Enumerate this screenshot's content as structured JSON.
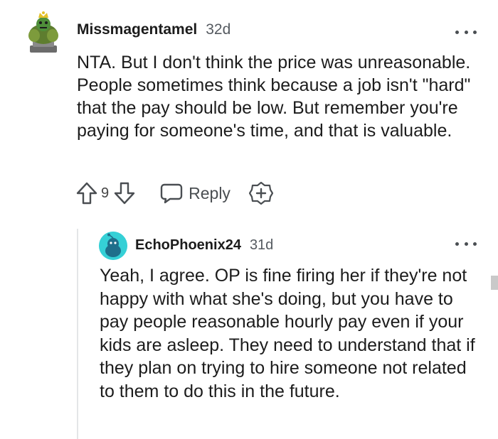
{
  "comment": {
    "username": "Missmagentamel",
    "age": "32d",
    "body": "NTA. But I don't think the price was unreasonable. People sometimes think because a job isn't \"hard\" that the pay should be low. But remember you're paying for someone's time, and that is valuable.",
    "votes": "9",
    "reply_label": "Reply"
  },
  "reply": {
    "username": "EchoPhoenix24",
    "age": "31d",
    "body": "Yeah, I agree. OP is fine firing her if they're not happy with what she's doing, but you have to pay people reasonable hourly pay even if your kids are asleep. They need to understand that if they plan on trying to hire someone not related to them to do this in the future."
  },
  "icons": {
    "upvote": "arrow-up-icon",
    "downvote": "arrow-down-icon",
    "reply": "speech-bubble-icon",
    "award": "award-plus-icon",
    "more": "ellipsis-icon"
  },
  "colors": {
    "text": "#1c1c1c",
    "meta": "#555a60",
    "reply_avatar": "#35d0d6",
    "thread_line": "#e4e6e8"
  }
}
